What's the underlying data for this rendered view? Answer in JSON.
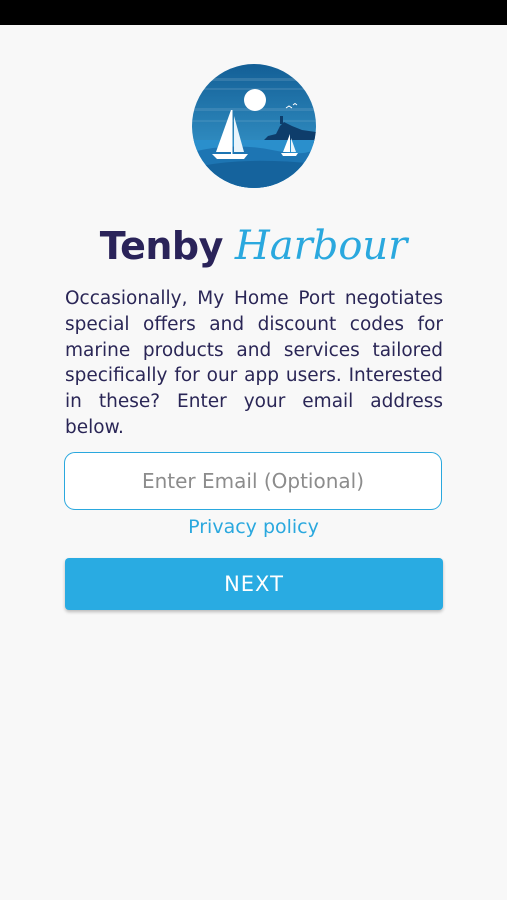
{
  "brand": {
    "name_part1": "Tenby",
    "name_part2": "Harbour",
    "primary_color": "#2a2359",
    "accent_color": "#2aa8de",
    "logo_icon": "harbour-sailboat-logo-icon"
  },
  "intro_text": "Occasionally, My Home Port negotiates special offers and discount codes for marine products and services tailored specifically for our app users. Interested in these? Enter your email address below.",
  "email": {
    "placeholder": "Enter Email (Optional)",
    "value": ""
  },
  "privacy_link": "Privacy policy",
  "next_button": "NEXT",
  "button_color": "#29abe2"
}
